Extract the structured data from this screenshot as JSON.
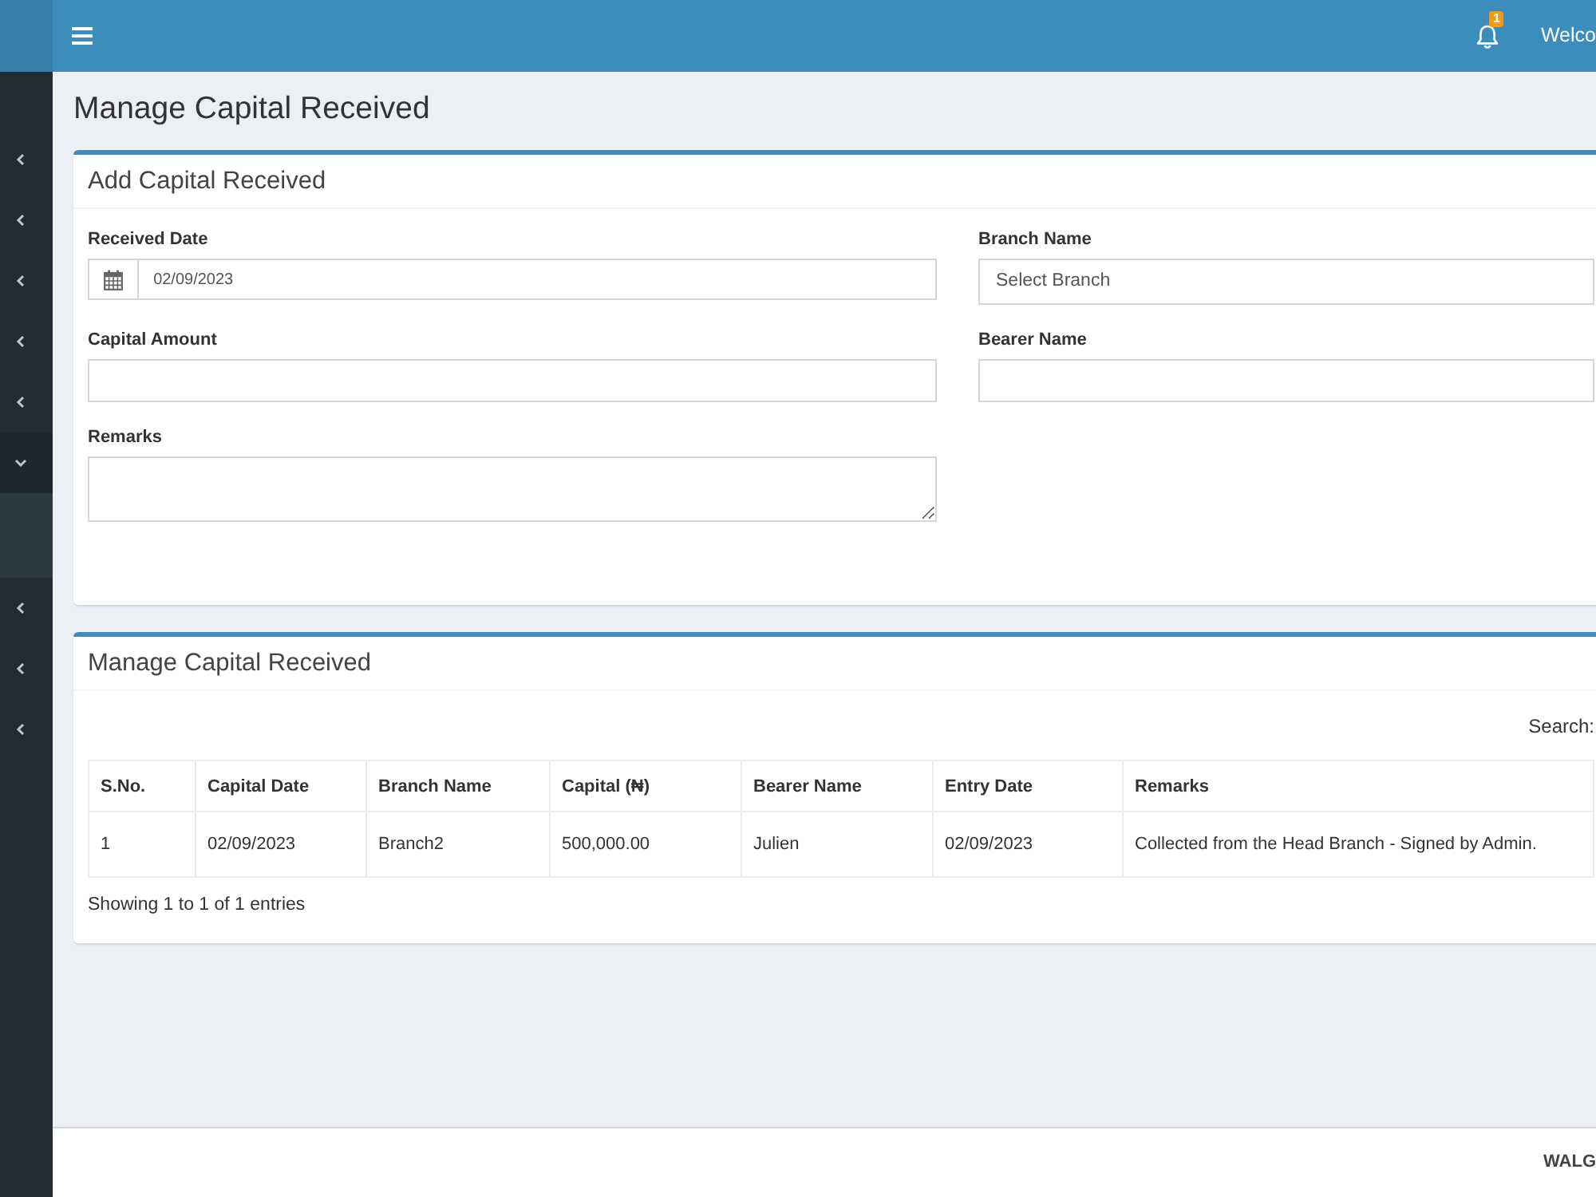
{
  "sidebar": {
    "items": [
      {
        "expanded": false
      },
      {
        "expanded": false
      },
      {
        "expanded": false
      },
      {
        "expanded": false
      },
      {
        "expanded": false
      },
      {
        "expanded": true
      },
      {
        "expanded": false
      },
      {
        "expanded": false
      },
      {
        "expanded": false
      }
    ]
  },
  "navbar": {
    "notification_count": "1",
    "welcome_text": "Welco"
  },
  "page_title": "Manage Capital Received",
  "form_box": {
    "title": "Add Capital Received",
    "fields": [
      {
        "kind": "date",
        "label": "Received Date",
        "value": "02/09/2023"
      },
      {
        "kind": "select",
        "label": "Branch Name",
        "value": "Select Branch"
      },
      {
        "kind": "text",
        "label": "Capital Amount"
      },
      {
        "kind": "text",
        "label": "Bearer Name"
      },
      {
        "kind": "textarea",
        "label": "Remarks"
      }
    ]
  },
  "table_box": {
    "title": "Manage Capital Received",
    "search_label": "Search:",
    "table": {
      "columns": [
        "S.No.",
        "Capital Date",
        "Branch Name",
        "Capital (₦)",
        "Bearer Name",
        "Entry Date",
        "Remarks"
      ],
      "rows": [
        [
          "1",
          "02/09/2023",
          "Branch2",
          "500,000.00",
          "Julien",
          "02/09/2023",
          "Collected from the Head Branch - Signed by Admin."
        ]
      ]
    },
    "info": "Showing 1 to 1 of 1 entries"
  },
  "footer": {
    "text": "WALG"
  }
}
